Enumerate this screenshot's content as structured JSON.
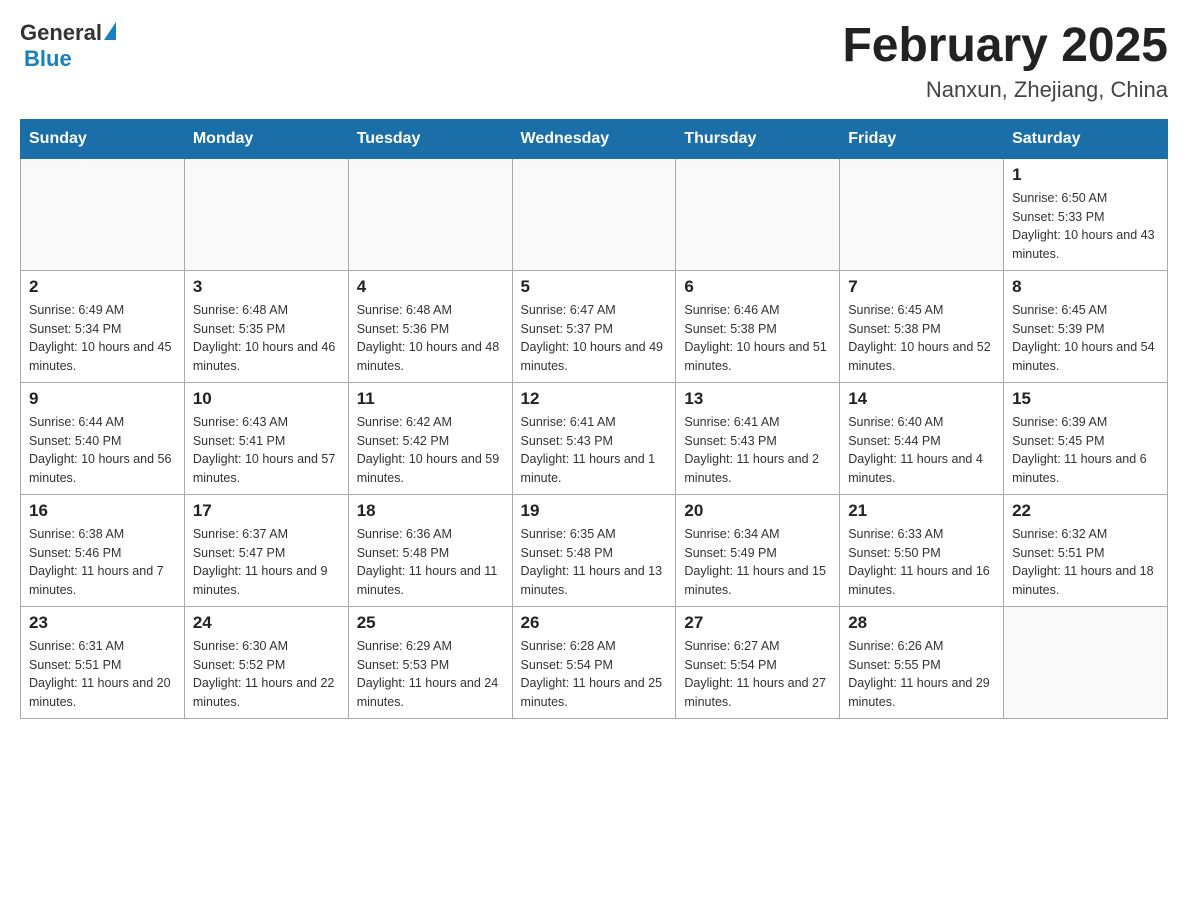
{
  "header": {
    "logo_general": "General",
    "logo_blue": "Blue",
    "month_title": "February 2025",
    "location": "Nanxun, Zhejiang, China"
  },
  "days_of_week": [
    "Sunday",
    "Monday",
    "Tuesday",
    "Wednesday",
    "Thursday",
    "Friday",
    "Saturday"
  ],
  "weeks": [
    [
      {
        "day": "",
        "sunrise": "",
        "sunset": "",
        "daylight": ""
      },
      {
        "day": "",
        "sunrise": "",
        "sunset": "",
        "daylight": ""
      },
      {
        "day": "",
        "sunrise": "",
        "sunset": "",
        "daylight": ""
      },
      {
        "day": "",
        "sunrise": "",
        "sunset": "",
        "daylight": ""
      },
      {
        "day": "",
        "sunrise": "",
        "sunset": "",
        "daylight": ""
      },
      {
        "day": "",
        "sunrise": "",
        "sunset": "",
        "daylight": ""
      },
      {
        "day": "1",
        "sunrise": "Sunrise: 6:50 AM",
        "sunset": "Sunset: 5:33 PM",
        "daylight": "Daylight: 10 hours and 43 minutes."
      }
    ],
    [
      {
        "day": "2",
        "sunrise": "Sunrise: 6:49 AM",
        "sunset": "Sunset: 5:34 PM",
        "daylight": "Daylight: 10 hours and 45 minutes."
      },
      {
        "day": "3",
        "sunrise": "Sunrise: 6:48 AM",
        "sunset": "Sunset: 5:35 PM",
        "daylight": "Daylight: 10 hours and 46 minutes."
      },
      {
        "day": "4",
        "sunrise": "Sunrise: 6:48 AM",
        "sunset": "Sunset: 5:36 PM",
        "daylight": "Daylight: 10 hours and 48 minutes."
      },
      {
        "day": "5",
        "sunrise": "Sunrise: 6:47 AM",
        "sunset": "Sunset: 5:37 PM",
        "daylight": "Daylight: 10 hours and 49 minutes."
      },
      {
        "day": "6",
        "sunrise": "Sunrise: 6:46 AM",
        "sunset": "Sunset: 5:38 PM",
        "daylight": "Daylight: 10 hours and 51 minutes."
      },
      {
        "day": "7",
        "sunrise": "Sunrise: 6:45 AM",
        "sunset": "Sunset: 5:38 PM",
        "daylight": "Daylight: 10 hours and 52 minutes."
      },
      {
        "day": "8",
        "sunrise": "Sunrise: 6:45 AM",
        "sunset": "Sunset: 5:39 PM",
        "daylight": "Daylight: 10 hours and 54 minutes."
      }
    ],
    [
      {
        "day": "9",
        "sunrise": "Sunrise: 6:44 AM",
        "sunset": "Sunset: 5:40 PM",
        "daylight": "Daylight: 10 hours and 56 minutes."
      },
      {
        "day": "10",
        "sunrise": "Sunrise: 6:43 AM",
        "sunset": "Sunset: 5:41 PM",
        "daylight": "Daylight: 10 hours and 57 minutes."
      },
      {
        "day": "11",
        "sunrise": "Sunrise: 6:42 AM",
        "sunset": "Sunset: 5:42 PM",
        "daylight": "Daylight: 10 hours and 59 minutes."
      },
      {
        "day": "12",
        "sunrise": "Sunrise: 6:41 AM",
        "sunset": "Sunset: 5:43 PM",
        "daylight": "Daylight: 11 hours and 1 minute."
      },
      {
        "day": "13",
        "sunrise": "Sunrise: 6:41 AM",
        "sunset": "Sunset: 5:43 PM",
        "daylight": "Daylight: 11 hours and 2 minutes."
      },
      {
        "day": "14",
        "sunrise": "Sunrise: 6:40 AM",
        "sunset": "Sunset: 5:44 PM",
        "daylight": "Daylight: 11 hours and 4 minutes."
      },
      {
        "day": "15",
        "sunrise": "Sunrise: 6:39 AM",
        "sunset": "Sunset: 5:45 PM",
        "daylight": "Daylight: 11 hours and 6 minutes."
      }
    ],
    [
      {
        "day": "16",
        "sunrise": "Sunrise: 6:38 AM",
        "sunset": "Sunset: 5:46 PM",
        "daylight": "Daylight: 11 hours and 7 minutes."
      },
      {
        "day": "17",
        "sunrise": "Sunrise: 6:37 AM",
        "sunset": "Sunset: 5:47 PM",
        "daylight": "Daylight: 11 hours and 9 minutes."
      },
      {
        "day": "18",
        "sunrise": "Sunrise: 6:36 AM",
        "sunset": "Sunset: 5:48 PM",
        "daylight": "Daylight: 11 hours and 11 minutes."
      },
      {
        "day": "19",
        "sunrise": "Sunrise: 6:35 AM",
        "sunset": "Sunset: 5:48 PM",
        "daylight": "Daylight: 11 hours and 13 minutes."
      },
      {
        "day": "20",
        "sunrise": "Sunrise: 6:34 AM",
        "sunset": "Sunset: 5:49 PM",
        "daylight": "Daylight: 11 hours and 15 minutes."
      },
      {
        "day": "21",
        "sunrise": "Sunrise: 6:33 AM",
        "sunset": "Sunset: 5:50 PM",
        "daylight": "Daylight: 11 hours and 16 minutes."
      },
      {
        "day": "22",
        "sunrise": "Sunrise: 6:32 AM",
        "sunset": "Sunset: 5:51 PM",
        "daylight": "Daylight: 11 hours and 18 minutes."
      }
    ],
    [
      {
        "day": "23",
        "sunrise": "Sunrise: 6:31 AM",
        "sunset": "Sunset: 5:51 PM",
        "daylight": "Daylight: 11 hours and 20 minutes."
      },
      {
        "day": "24",
        "sunrise": "Sunrise: 6:30 AM",
        "sunset": "Sunset: 5:52 PM",
        "daylight": "Daylight: 11 hours and 22 minutes."
      },
      {
        "day": "25",
        "sunrise": "Sunrise: 6:29 AM",
        "sunset": "Sunset: 5:53 PM",
        "daylight": "Daylight: 11 hours and 24 minutes."
      },
      {
        "day": "26",
        "sunrise": "Sunrise: 6:28 AM",
        "sunset": "Sunset: 5:54 PM",
        "daylight": "Daylight: 11 hours and 25 minutes."
      },
      {
        "day": "27",
        "sunrise": "Sunrise: 6:27 AM",
        "sunset": "Sunset: 5:54 PM",
        "daylight": "Daylight: 11 hours and 27 minutes."
      },
      {
        "day": "28",
        "sunrise": "Sunrise: 6:26 AM",
        "sunset": "Sunset: 5:55 PM",
        "daylight": "Daylight: 11 hours and 29 minutes."
      },
      {
        "day": "",
        "sunrise": "",
        "sunset": "",
        "daylight": ""
      }
    ]
  ]
}
